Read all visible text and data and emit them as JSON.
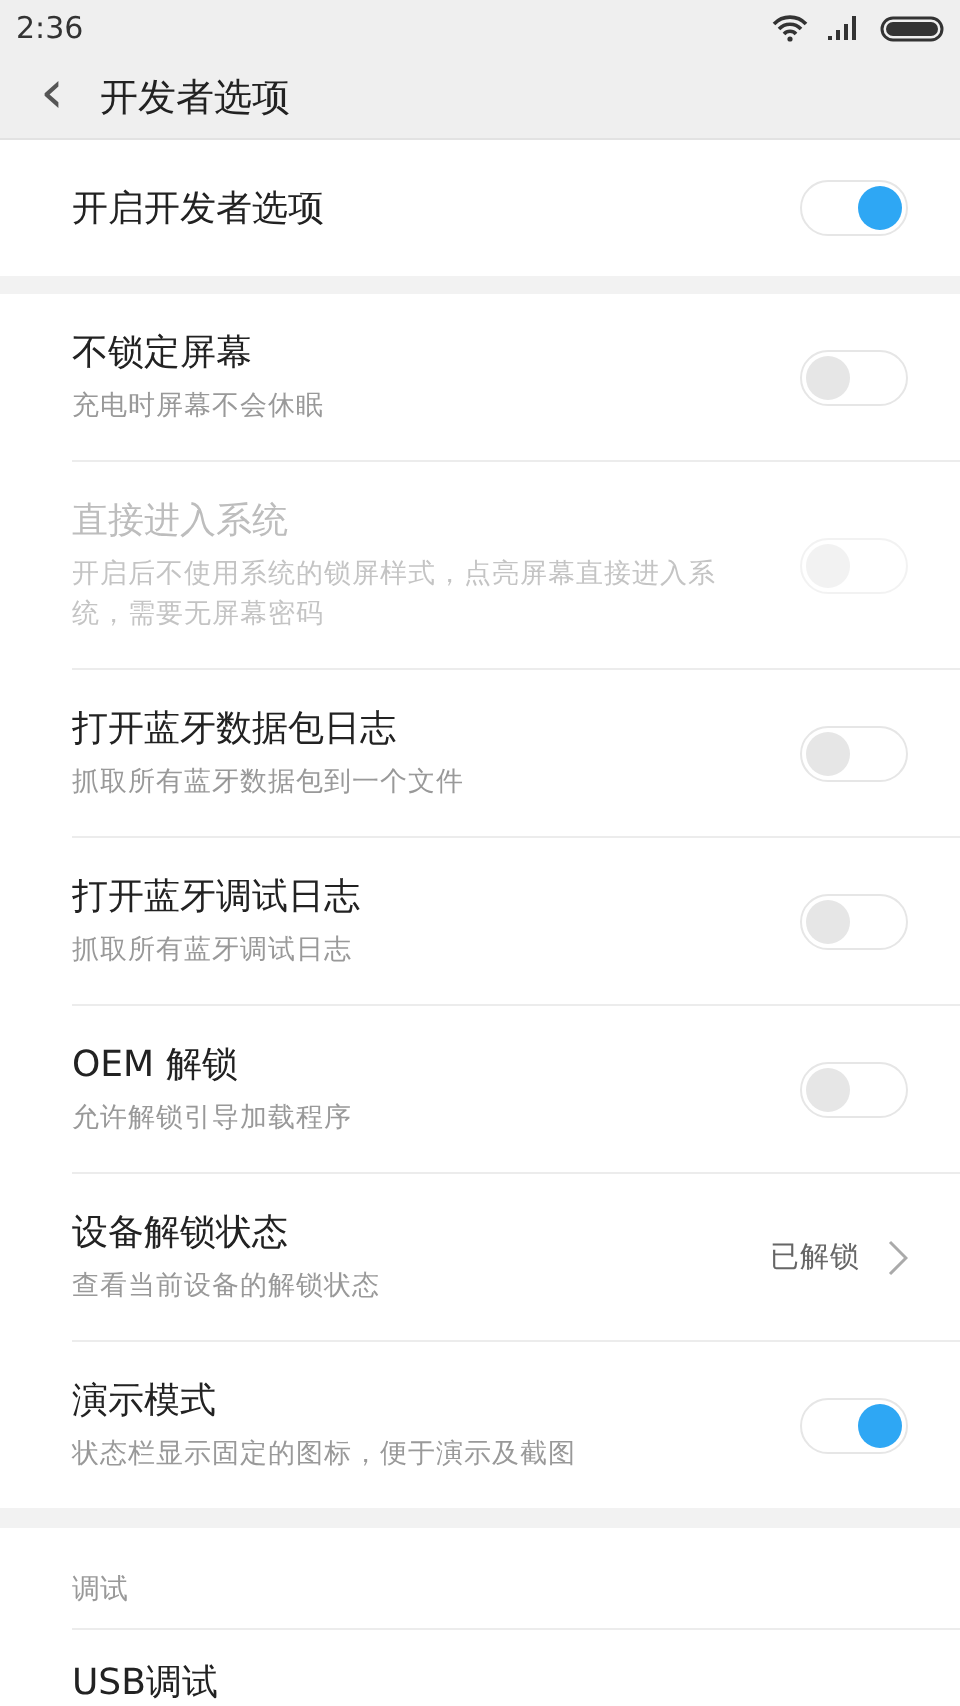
{
  "status_bar": {
    "time": "2:36"
  },
  "header": {
    "back_icon": "‹",
    "title": "开发者选项"
  },
  "master": {
    "label": "开启开发者选项",
    "on": true
  },
  "settings": [
    {
      "kind": "toggle",
      "title": "不锁定屏幕",
      "subtitle": "充电时屏幕不会休眠",
      "on": false,
      "disabled": false
    },
    {
      "kind": "toggle",
      "title": "直接进入系统",
      "subtitle": "开启后不使用系统的锁屏样式，点亮屏幕直接进入系统，需要无屏幕密码",
      "on": false,
      "disabled": true
    },
    {
      "kind": "toggle",
      "title": "打开蓝牙数据包日志",
      "subtitle": "抓取所有蓝牙数据包到一个文件",
      "on": false,
      "disabled": false
    },
    {
      "kind": "toggle",
      "title": "打开蓝牙调试日志",
      "subtitle": "抓取所有蓝牙调试日志",
      "on": false,
      "disabled": false
    },
    {
      "kind": "toggle",
      "title": "OEM 解锁",
      "subtitle": "允许解锁引导加载程序",
      "on": false,
      "disabled": false
    },
    {
      "kind": "link",
      "title": "设备解锁状态",
      "subtitle": "查看当前设备的解锁状态",
      "value": "已解锁",
      "disabled": false
    },
    {
      "kind": "toggle",
      "title": "演示模式",
      "subtitle": "状态栏显示固定的图标，便于演示及截图",
      "on": true,
      "disabled": false
    }
  ],
  "debug_section": {
    "header": "调试",
    "items": [
      {
        "title": "USB调试"
      }
    ]
  }
}
